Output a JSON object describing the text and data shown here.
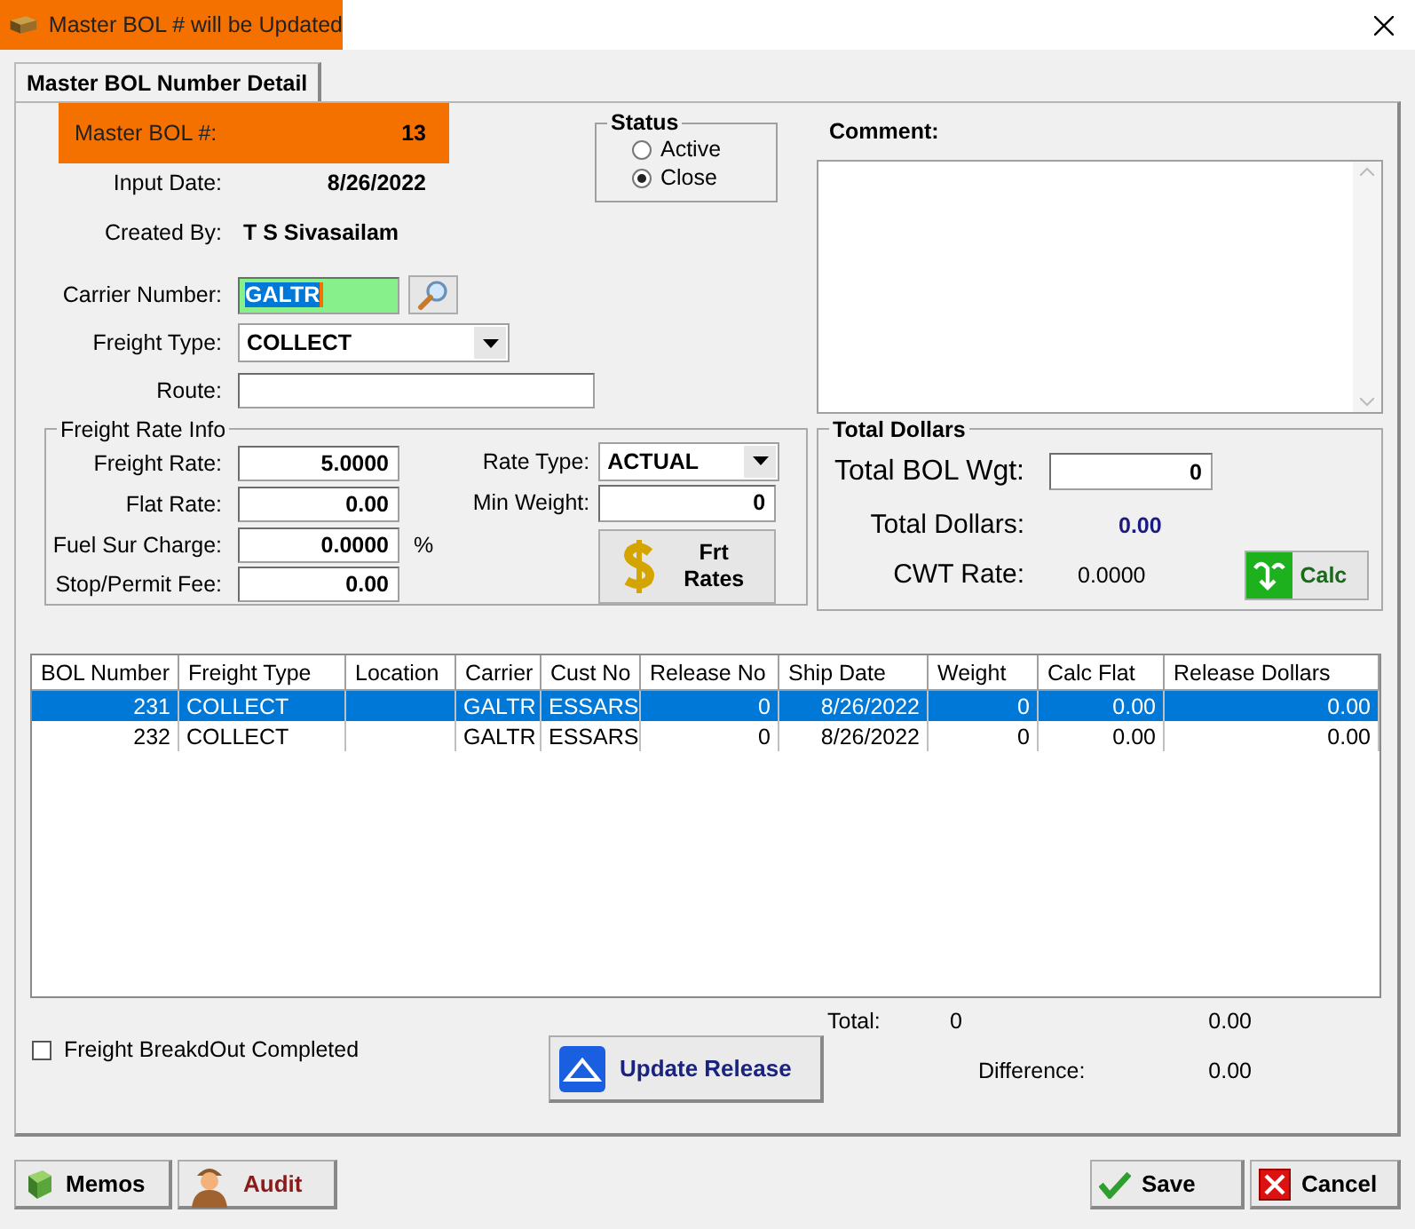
{
  "window": {
    "title": "Master BOL # will be Updated"
  },
  "tabs": [
    {
      "label": "Master BOL Number Detail",
      "selected": true
    }
  ],
  "master_bol": {
    "label": "Master BOL #:",
    "value": "13"
  },
  "input_date": {
    "label": "Input Date:",
    "value": "8/26/2022"
  },
  "created_by": {
    "label": "Created By:",
    "value": "T S Sivasailam"
  },
  "carrier": {
    "label": "Carrier Number:",
    "value": "GALTR",
    "highlighted": true
  },
  "freight_type": {
    "label": "Freight Type:",
    "value": "COLLECT"
  },
  "route": {
    "label": "Route:"
  },
  "status": {
    "title": "Status",
    "options": [
      {
        "label": "Active",
        "selected": false
      },
      {
        "label": "Close",
        "selected": true
      }
    ]
  },
  "comment": {
    "label": "Comment:"
  },
  "freight_rate_info": {
    "title": "Freight Rate Info",
    "fields": [
      {
        "label": "Freight Rate:",
        "value": "5.0000"
      },
      {
        "label": "Flat Rate:",
        "value": "0.00"
      },
      {
        "label": "Fuel Sur Charge:",
        "value": "0.0000",
        "suffix": "%"
      },
      {
        "label": "Stop/Permit Fee:",
        "value": "0.00"
      }
    ],
    "rate_type": {
      "label": "Rate Type:",
      "value": "ACTUAL"
    },
    "min_weight": {
      "label": "Min Weight:",
      "value": "0"
    },
    "rates_button": "Frt Rates"
  },
  "total_dollars": {
    "title": "Total Dollars",
    "bol_wgt": {
      "label": "Total BOL Wgt:",
      "value": "0"
    },
    "dollars": {
      "label": "Total Dollars:",
      "value": "0.00"
    },
    "cwt": {
      "label": "CWT Rate:",
      "value": "0.0000"
    },
    "calc_button": "Calc"
  },
  "table": {
    "columns": [
      "BOL Number",
      "Freight Type",
      "Location",
      "Carrier",
      "Cust No",
      "Release No",
      "Ship Date",
      "Weight",
      "Calc Flat",
      "Release Dollars"
    ],
    "rows": [
      {
        "selected": true,
        "cells": [
          "231",
          "COLLECT",
          "",
          "GALTR",
          "ESSARS",
          "0",
          "8/26/2022",
          "0",
          "0.00",
          "0.00"
        ]
      },
      {
        "selected": false,
        "cells": [
          "232",
          "COLLECT",
          "",
          "GALTR",
          "ESSARS",
          "0",
          "8/26/2022",
          "0",
          "0.00",
          "0.00"
        ]
      }
    ]
  },
  "breakout": {
    "label": "Freight BreakdOut Completed",
    "checked": false
  },
  "update_button": "Update Release",
  "totals": {
    "label": "Total:",
    "weight": "0",
    "dollars": "0.00"
  },
  "difference": {
    "label": "Difference:",
    "value": "0.00"
  },
  "footer_buttons": [
    {
      "kind": "memos",
      "label": "Memos"
    },
    {
      "kind": "audit",
      "label": "Audit"
    },
    {
      "kind": "save",
      "label": "Save"
    },
    {
      "kind": "cancel",
      "label": "Cancel"
    }
  ]
}
